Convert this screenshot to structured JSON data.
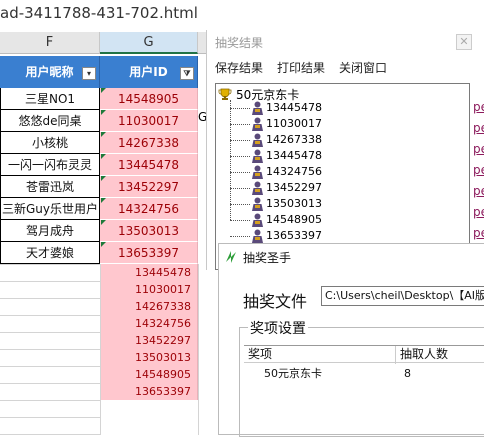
{
  "excel": {
    "file_title": "ad-3411788-431-702.html",
    "columns": [
      "F",
      "G"
    ],
    "headers": {
      "nickname": "用户昵称",
      "user_id": "用户ID"
    },
    "filter_icon_f": "▾",
    "filter_icon_g": "⧩",
    "rows": [
      {
        "name": "三星NO1",
        "id": "14548905"
      },
      {
        "name": "悠悠de同桌",
        "id": "11030017"
      },
      {
        "name": "小核桃",
        "id": "14267338"
      },
      {
        "name": "一闪一闪布灵灵",
        "id": "13445478"
      },
      {
        "name": "苍雷迅岚",
        "id": "13452297"
      },
      {
        "name": "三新Guy乐世用户",
        "id": "14324756"
      },
      {
        "name": "驾月成舟",
        "id": "13503013"
      },
      {
        "name": "天才婆娘",
        "id": "13653397"
      }
    ],
    "overflow_char": "G",
    "result_ids": [
      "13445478",
      "11030017",
      "14267338",
      "14324756",
      "13452297",
      "13503013",
      "14548905",
      "13653397"
    ]
  },
  "results_window": {
    "title": "抽奖结果",
    "close_label": "✕",
    "menu": [
      "保存结果",
      "打印结果",
      "关闭窗口"
    ],
    "prize_name": "50元京东卡",
    "winners": [
      "13445478",
      "11030017",
      "14267338",
      "13445478",
      "14324756",
      "13452297",
      "13503013",
      "14548905",
      "13653397"
    ],
    "side_link_text": "pe"
  },
  "main_window": {
    "title": "抽奖圣手",
    "file_label": "抽奖文件",
    "file_path": "C:\\Users\\cheil\\Desktop\\【AI版抽",
    "group_title": "奖项设置",
    "table_headers": [
      "奖项",
      "抽取人数"
    ],
    "table_rows": [
      {
        "prize": "50元京东卡",
        "count": "8"
      }
    ]
  },
  "colors": {
    "header_blue": "#3a7fd0",
    "pink_fill": "#ffc7ce",
    "pink_text": "#9c0006",
    "link": "#8c1a5c"
  }
}
